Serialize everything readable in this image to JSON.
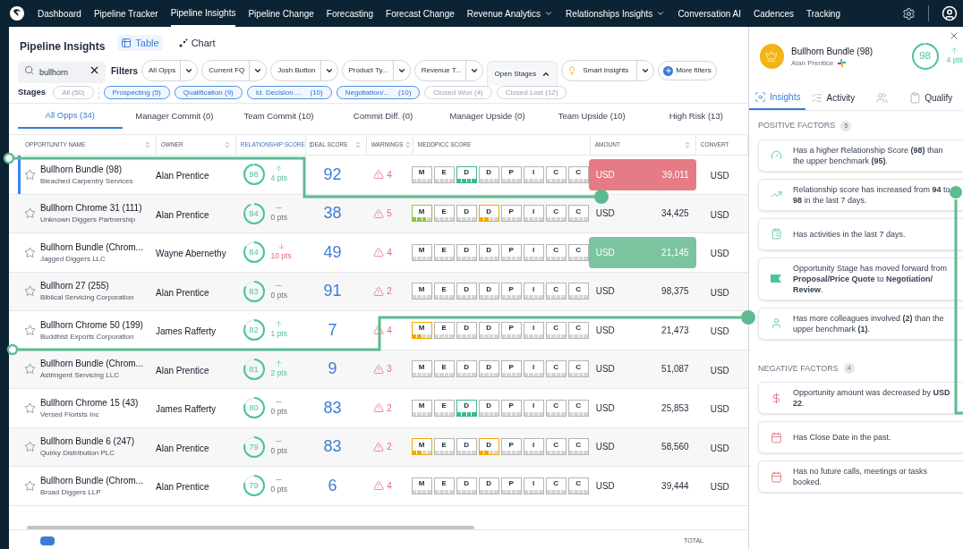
{
  "nav": {
    "items": [
      {
        "label": "Dashboard",
        "selected": false,
        "has_menu": false
      },
      {
        "label": "Pipeline Tracker",
        "selected": false,
        "has_menu": false
      },
      {
        "label": "Pipeline Insights",
        "selected": true,
        "has_menu": false
      },
      {
        "label": "Pipeline Change",
        "selected": false,
        "has_menu": false
      },
      {
        "label": "Forecasting",
        "selected": false,
        "has_menu": false
      },
      {
        "label": "Forecast Change",
        "selected": false,
        "has_menu": false
      },
      {
        "label": "Revenue Analytics",
        "selected": false,
        "has_menu": true
      },
      {
        "label": "Relationships Insights",
        "selected": false,
        "has_menu": true
      },
      {
        "label": "Conversation AI",
        "selected": false,
        "has_menu": false
      },
      {
        "label": "Cadences",
        "selected": false,
        "has_menu": false
      },
      {
        "label": "Tracking",
        "selected": false,
        "has_menu": false
      }
    ]
  },
  "page": {
    "title": "Pipeline Insights",
    "views": [
      {
        "label": "Table",
        "kind": "table",
        "selected": true
      },
      {
        "label": "Chart",
        "kind": "chart",
        "selected": false
      }
    ],
    "search": {
      "value": "bullhorn"
    },
    "filters_label": "Filters",
    "filters": [
      {
        "label": "All Opps",
        "kind": "dropdown"
      },
      {
        "label": "Current FQ",
        "kind": "dropdown"
      },
      {
        "label": "Josh Button",
        "kind": "dropdown"
      },
      {
        "label": "Product Ty...",
        "kind": "dropdown"
      },
      {
        "label": "Revenue T...",
        "kind": "dropdown"
      },
      {
        "label": "Open Stages",
        "kind": "expanded"
      },
      {
        "label": "Smart Insights",
        "kind": "insights"
      },
      {
        "label": "More filters",
        "kind": "more"
      }
    ],
    "stages_label": "Stages",
    "stages": [
      {
        "label": "All (50)",
        "selected": false
      },
      {
        "label": "Prospecting (5)",
        "selected": true
      },
      {
        "label": "Qualification (9)",
        "selected": true
      },
      {
        "label": "Id. Decision ...",
        "count": "(10)",
        "selected": true
      },
      {
        "label": "Negotiation/...",
        "count": "(10)",
        "selected": true
      },
      {
        "label": "Closed Won (4)",
        "selected": false
      },
      {
        "label": "Closed Lost (12)",
        "selected": false
      }
    ],
    "tabs": [
      {
        "label": "All Opps (34)",
        "selected": true
      },
      {
        "label": "Manager Commit (0)",
        "selected": false
      },
      {
        "label": "Team Commit (10)",
        "selected": false
      },
      {
        "label": "Commit Diff. (0)",
        "selected": false
      },
      {
        "label": "Manager Upside (0)",
        "selected": false
      },
      {
        "label": "Team Upside (10)",
        "selected": false
      },
      {
        "label": "High Risk (13)",
        "selected": false
      }
    ]
  },
  "table": {
    "columns": [
      {
        "label": "OPPORTUNITY NAME",
        "sortable": true,
        "sorted": false
      },
      {
        "label": "OWNER",
        "sortable": true,
        "sorted": false
      },
      {
        "label": "RELATIONSHIP SCORE",
        "sortable": true,
        "sorted": true
      },
      {
        "label": "DEAL SCORE",
        "sortable": true,
        "sorted": false
      },
      {
        "label": "WARNINGS",
        "sortable": true,
        "sorted": false
      },
      {
        "label": "MEDDPICC SCORE",
        "sortable": false,
        "sorted": false
      },
      {
        "label": "AMOUNT",
        "sortable": true,
        "sorted": false
      },
      {
        "label": "CONVERT",
        "sortable": false,
        "sorted": false
      }
    ],
    "rows": [
      {
        "name": "Bullhorn Bundle (98)",
        "account": "Bleached Carpentry Services",
        "owner": "Alan Prentice",
        "rel_score": "98",
        "trend": {
          "kind": "up",
          "text": "4 pts"
        },
        "deal_score": "92",
        "warnings": "4",
        "meddpicc": [
          {
            "letter": "M",
            "color": "#b5b5b5"
          },
          {
            "letter": "E",
            "color": "#b5b5b5"
          },
          {
            "letter": "D",
            "color": "#3dba8c",
            "level": 1
          },
          {
            "letter": "D",
            "color": "#b5b5b5"
          },
          {
            "letter": "P",
            "color": "#b5b5b5"
          },
          {
            "letter": "I",
            "color": "#b5b5b5"
          },
          {
            "letter": "C",
            "color": "#b5b5b5"
          },
          {
            "letter": "C",
            "color": "#b5b5b5"
          }
        ],
        "amount": {
          "currency": "USD",
          "value": "39,011",
          "kind": "decrease"
        },
        "convert": "USD",
        "selected": true,
        "starred": false
      },
      {
        "name": "Bullhorn Chrome 31 (111)",
        "account": "Unknown Diggers Partnership",
        "owner": "Alan Prentice",
        "rel_score": "94",
        "trend": {
          "kind": "flat",
          "text": "0 pts"
        },
        "deal_score": "38",
        "warnings": "5",
        "meddpicc": [
          {
            "letter": "M",
            "color": "#8dc63f",
            "level": 0.75
          },
          {
            "letter": "E",
            "color": "#b5b5b5"
          },
          {
            "letter": "D",
            "color": "#b5b5b5"
          },
          {
            "letter": "D",
            "color": "#f0aa00",
            "level": 0.5
          },
          {
            "letter": "P",
            "color": "#b5b5b5"
          },
          {
            "letter": "I",
            "color": "#b5b5b5"
          },
          {
            "letter": "C",
            "color": "#b5b5b5"
          },
          {
            "letter": "C",
            "color": "#b5b5b5"
          }
        ],
        "amount": {
          "currency": "USD",
          "value": "34,425",
          "kind": "plain"
        },
        "convert": "USD",
        "selected": false,
        "starred": false
      },
      {
        "name": "Bullhorn Bundle (Chrom...",
        "account": "Jagged Diggers LLC",
        "owner": "Wayne Abernethy",
        "rel_score": "84",
        "trend": {
          "kind": "down",
          "text": "10 pts"
        },
        "deal_score": "49",
        "warnings": "4",
        "meddpicc": [
          {
            "letter": "M",
            "color": "#b5b5b5"
          },
          {
            "letter": "E",
            "color": "#b5b5b5"
          },
          {
            "letter": "D",
            "color": "#b5b5b5"
          },
          {
            "letter": "D",
            "color": "#b5b5b5"
          },
          {
            "letter": "P",
            "color": "#b5b5b5"
          },
          {
            "letter": "I",
            "color": "#b5b5b5"
          },
          {
            "letter": "C",
            "color": "#b5b5b5"
          },
          {
            "letter": "C",
            "color": "#b5b5b5"
          }
        ],
        "amount": {
          "currency": "USD",
          "value": "21,145",
          "kind": "increase"
        },
        "convert": "USD",
        "selected": false,
        "starred": false
      },
      {
        "name": "Bullhorn 27 (255)",
        "account": "Biblical Servicing Corporation",
        "owner": "Alan Prentice",
        "rel_score": "83",
        "trend": {
          "kind": "flat",
          "text": "0 pts"
        },
        "deal_score": "91",
        "warnings": "2",
        "meddpicc": [
          {
            "letter": "M",
            "color": "#b5b5b5"
          },
          {
            "letter": "E",
            "color": "#b5b5b5"
          },
          {
            "letter": "D",
            "color": "#b5b5b5"
          },
          {
            "letter": "D",
            "color": "#b5b5b5"
          },
          {
            "letter": "P",
            "color": "#b5b5b5"
          },
          {
            "letter": "I",
            "color": "#b5b5b5"
          },
          {
            "letter": "C",
            "color": "#b5b5b5"
          },
          {
            "letter": "C",
            "color": "#b5b5b5"
          }
        ],
        "amount": {
          "currency": "USD",
          "value": "98,375",
          "kind": "plain"
        },
        "convert": "USD",
        "selected": false,
        "starred": false
      },
      {
        "name": "Bullhorn Chrome 50 (199)",
        "account": "Buddhist Exports Corporation",
        "owner": "James Rafferty",
        "rel_score": "82",
        "trend": {
          "kind": "up",
          "text": "1 pts"
        },
        "deal_score": "7",
        "warnings": "4",
        "meddpicc": [
          {
            "letter": "M",
            "color": "#f0aa00",
            "level": 0.5
          },
          {
            "letter": "E",
            "color": "#b5b5b5"
          },
          {
            "letter": "D",
            "color": "#b5b5b5"
          },
          {
            "letter": "D",
            "color": "#b5b5b5"
          },
          {
            "letter": "P",
            "color": "#b5b5b5"
          },
          {
            "letter": "I",
            "color": "#b5b5b5"
          },
          {
            "letter": "C",
            "color": "#b5b5b5"
          },
          {
            "letter": "C",
            "color": "#b5b5b5"
          }
        ],
        "amount": {
          "currency": "USD",
          "value": "21,473",
          "kind": "plain"
        },
        "convert": "USD",
        "selected": false,
        "starred": false
      },
      {
        "name": "Bullhorn Bundle (Chrom...",
        "account": "Astringent Servicing LLC",
        "owner": "Alan Prentice",
        "rel_score": "81",
        "trend": {
          "kind": "up",
          "text": "2 pts"
        },
        "deal_score": "9",
        "warnings": "3",
        "meddpicc": [
          {
            "letter": "M",
            "color": "#b5b5b5"
          },
          {
            "letter": "E",
            "color": "#b5b5b5"
          },
          {
            "letter": "D",
            "color": "#b5b5b5"
          },
          {
            "letter": "D",
            "color": "#b5b5b5"
          },
          {
            "letter": "P",
            "color": "#b5b5b5"
          },
          {
            "letter": "I",
            "color": "#b5b5b5"
          },
          {
            "letter": "C",
            "color": "#b5b5b5"
          },
          {
            "letter": "C",
            "color": "#b5b5b5"
          }
        ],
        "amount": {
          "currency": "USD",
          "value": "51,087",
          "kind": "plain"
        },
        "convert": "USD",
        "selected": false,
        "starred": false
      },
      {
        "name": "Bullhorn Chrome 15 (43)",
        "account": "Versed Florists Inc",
        "owner": "James Rafferty",
        "rel_score": "80",
        "trend": {
          "kind": "flat",
          "text": "0 pts"
        },
        "deal_score": "83",
        "warnings": "2",
        "meddpicc": [
          {
            "letter": "M",
            "color": "#b5b5b5"
          },
          {
            "letter": "E",
            "color": "#b5b5b5"
          },
          {
            "letter": "D",
            "color": "#3dba8c",
            "level": 1
          },
          {
            "letter": "D",
            "color": "#b5b5b5"
          },
          {
            "letter": "P",
            "color": "#b5b5b5"
          },
          {
            "letter": "I",
            "color": "#b5b5b5"
          },
          {
            "letter": "C",
            "color": "#b5b5b5"
          },
          {
            "letter": "C",
            "color": "#b5b5b5"
          }
        ],
        "amount": {
          "currency": "USD",
          "value": "25,853",
          "kind": "plain"
        },
        "convert": "USD",
        "selected": false,
        "starred": false
      },
      {
        "name": "Bullhorn Bundle 6 (247)",
        "account": "Quirky Distribution PLC",
        "owner": "Alan Prentice",
        "rel_score": "79",
        "trend": {
          "kind": "flat",
          "text": "0 pts"
        },
        "deal_score": "83",
        "warnings": "2",
        "meddpicc": [
          {
            "letter": "M",
            "color": "#f0aa00",
            "level": 0.5
          },
          {
            "letter": "E",
            "color": "#b5b5b5"
          },
          {
            "letter": "D",
            "color": "#b5b5b5"
          },
          {
            "letter": "D",
            "color": "#f0aa00",
            "level": 0.5
          },
          {
            "letter": "P",
            "color": "#b5b5b5"
          },
          {
            "letter": "I",
            "color": "#b5b5b5"
          },
          {
            "letter": "C",
            "color": "#b5b5b5"
          },
          {
            "letter": "C",
            "color": "#b5b5b5"
          }
        ],
        "amount": {
          "currency": "USD",
          "value": "58,560",
          "kind": "plain"
        },
        "convert": "USD",
        "selected": false,
        "starred": false
      },
      {
        "name": "Bullhorn Bundle (Chrom...",
        "account": "Broad Diggers LLP",
        "owner": "Alan Prentice",
        "rel_score": "79",
        "trend": {
          "kind": "flat",
          "text": "0 pts"
        },
        "deal_score": "6",
        "warnings": "4",
        "meddpicc": [
          {
            "letter": "M",
            "color": "#b5b5b5"
          },
          {
            "letter": "E",
            "color": "#b5b5b5"
          },
          {
            "letter": "D",
            "color": "#b5b5b5"
          },
          {
            "letter": "D",
            "color": "#b5b5b5"
          },
          {
            "letter": "P",
            "color": "#b5b5b5"
          },
          {
            "letter": "I",
            "color": "#b5b5b5"
          },
          {
            "letter": "C",
            "color": "#b5b5b5"
          },
          {
            "letter": "C",
            "color": "#b5b5b5"
          }
        ],
        "amount": {
          "currency": "USD",
          "value": "39,444",
          "kind": "plain"
        },
        "convert": "USD",
        "selected": false,
        "starred": false
      }
    ],
    "total_label": "TOTAL"
  },
  "panel": {
    "title": "Bullhorn Bundle (98)",
    "owner": "Alan Prentice",
    "score": "98",
    "trend": {
      "kind": "up",
      "text": "4 pts"
    },
    "tabs": [
      {
        "label": "Insights",
        "kind": "insights",
        "selected": true
      },
      {
        "label": "Activity",
        "kind": "activity",
        "selected": false
      },
      {
        "kind": "people",
        "selected": false
      },
      {
        "label": "Qualify",
        "kind": "qualify",
        "selected": false
      }
    ],
    "sections": [
      {
        "title": "POSITIVE FACTORS",
        "count": "5",
        "kind": "positive",
        "items": [
          {
            "kind": "gauge",
            "text": "Has a higher Relationship Score **(98)** than the upper benchmark **(95)**."
          },
          {
            "kind": "trend",
            "text": "Relationship score has increased from **94** to **98** in the last 7 days."
          },
          {
            "kind": "checklist",
            "text": "Has activities in the last 7 days."
          },
          {
            "kind": "flag",
            "text": "Opportunity Stage has moved forward from **Proposal/Price Quote** to **Negotiation/ Review**."
          },
          {
            "kind": "person",
            "text": "Has more colleagues involved **(2)** than the upper benchmark **(1)**."
          }
        ]
      },
      {
        "title": "NEGATIVE FACTORS",
        "count": "4",
        "kind": "negative",
        "items": [
          {
            "kind": "dollar",
            "text": "Opportunity amount was decreased by **USD 22**."
          },
          {
            "kind": "calendar",
            "text": "Has Close Date in the past."
          },
          {
            "kind": "calendar",
            "text": "Has no future calls, meetings or tasks booked."
          }
        ]
      }
    ]
  }
}
